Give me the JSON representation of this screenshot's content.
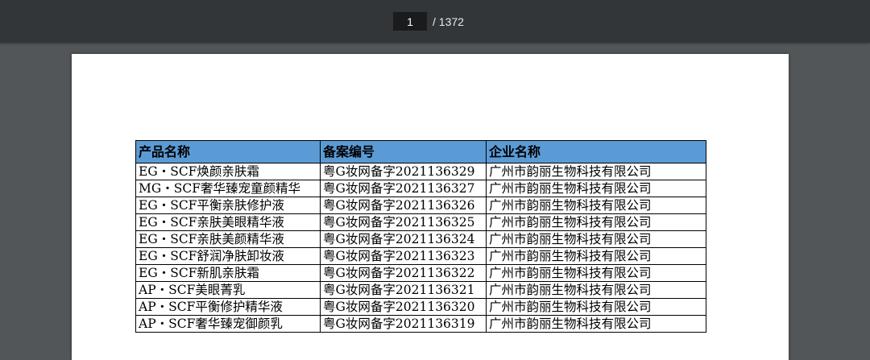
{
  "toolbar": {
    "current_page": "1",
    "total_pages": "/ 1372"
  },
  "table": {
    "headers": [
      "产品名称",
      "备案编号",
      "企业名称"
    ],
    "rows": [
      [
        "EG・SCF焕颜亲肤霜",
        "粤G妆网备字2021136329",
        "广州市韵丽生物科技有限公司"
      ],
      [
        "MG・SCF奢华臻宠童颜精华",
        "粤G妆网备字2021136327",
        "广州市韵丽生物科技有限公司"
      ],
      [
        "EG・SCF平衡亲肤修护液",
        "粤G妆网备字2021136326",
        "广州市韵丽生物科技有限公司"
      ],
      [
        "EG・SCF亲肤美眼精华液",
        "粤G妆网备字2021136325",
        "广州市韵丽生物科技有限公司"
      ],
      [
        "EG・SCF亲肤美颜精华液",
        "粤G妆网备字2021136324",
        "广州市韵丽生物科技有限公司"
      ],
      [
        "EG・SCF舒润净肤卸妆液",
        "粤G妆网备字2021136323",
        "广州市韵丽生物科技有限公司"
      ],
      [
        "EG・SCF新肌亲肤霜",
        "粤G妆网备字2021136322",
        "广州市韵丽生物科技有限公司"
      ],
      [
        "AP・SCF美眼菁乳",
        "粤G妆网备字2021136321",
        "广州市韵丽生物科技有限公司"
      ],
      [
        "AP・SCF平衡修护精华液",
        "粤G妆网备字2021136320",
        "广州市韵丽生物科技有限公司"
      ],
      [
        "AP・SCF奢华臻宠御颜乳",
        "粤G妆网备字2021136319",
        "广州市韵丽生物科技有限公司"
      ]
    ]
  },
  "colors": {
    "toolbar_bg": "#323639",
    "viewer_bg": "#525659",
    "header_fill": "#5b9bd5"
  }
}
